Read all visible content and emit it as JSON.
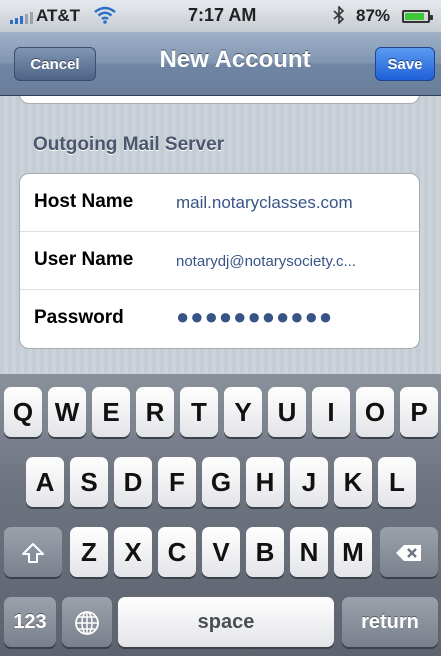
{
  "status_bar": {
    "carrier": "AT&T",
    "time": "7:17 AM",
    "battery_percent": "87%",
    "battery_level": 0.87,
    "icons": [
      "signal-icon",
      "wifi-icon",
      "bluetooth-icon",
      "battery-icon"
    ]
  },
  "nav": {
    "cancel_label": "Cancel",
    "title": "New Account",
    "save_label": "Save"
  },
  "outgoing": {
    "header": "Outgoing Mail Server",
    "host_label": "Host Name",
    "host_value": "mail.notaryclasses.com",
    "user_label": "User Name",
    "user_value": "notarydj@notarysociety.c...",
    "password_label": "Password",
    "password_value": "●●●●●●●●●●●"
  },
  "keyboard": {
    "row1": [
      "Q",
      "W",
      "E",
      "R",
      "T",
      "Y",
      "U",
      "I",
      "O",
      "P"
    ],
    "row2": [
      "A",
      "S",
      "D",
      "F",
      "G",
      "H",
      "J",
      "K",
      "L"
    ],
    "row3": [
      "Z",
      "X",
      "C",
      "V",
      "B",
      "N",
      "M"
    ],
    "numbers_label": "123",
    "space_label": "space",
    "return_label": "return",
    "icons": [
      "shift-icon",
      "delete-icon",
      "globe-icon"
    ]
  },
  "colors": {
    "nav_bar": "#7a8eab",
    "save_button": "#2f74e4",
    "value_text": "#385487",
    "section_header": "#4c566c"
  }
}
